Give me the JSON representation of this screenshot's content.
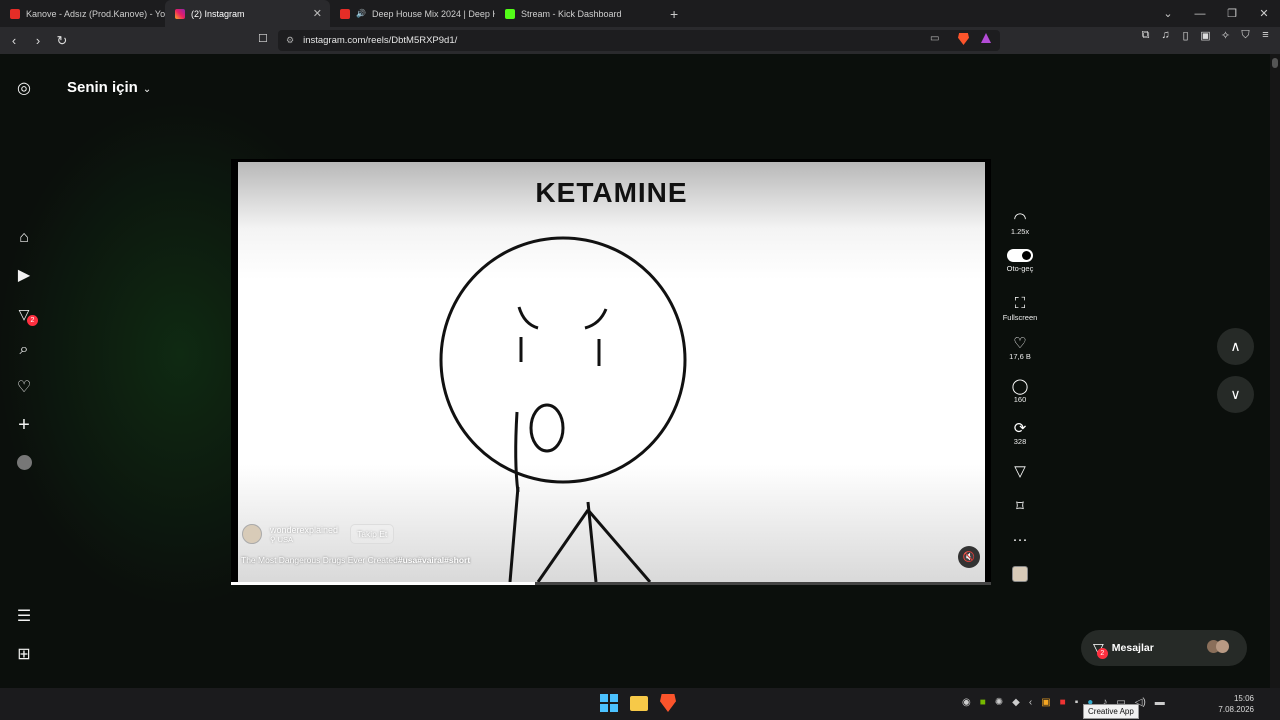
{
  "browser": {
    "tabs": [
      {
        "title": "Kanove - Adsız (Prod.Kanove) - YouTu",
        "favicon": "youtube-icon",
        "active": false
      },
      {
        "title": "(2) Instagram",
        "favicon": "instagram-icon",
        "active": true
      },
      {
        "title": "Deep House Mix 2024 | Deep Ho",
        "favicon": "youtube-icon",
        "active": false
      },
      {
        "title": "Stream - Kick Dashboard",
        "favicon": "kick-icon",
        "active": false
      }
    ],
    "url": "instagram.com/reels/DbtM5RXP9d1/"
  },
  "instagram": {
    "feed_title": "Senin için",
    "nav_badge": "2",
    "video": {
      "title_text": "KETAMINE",
      "owner": "wonderexplained",
      "location": "USA",
      "follow_label": "Takip Et",
      "caption_text": "The Most Dangerous Drugs Ever Created",
      "caption_tags": "#usa#vairal#short",
      "progress": 0.4
    },
    "actions": {
      "speed": "1.25x",
      "autoplay_label": "Oto-geç",
      "fullscreen_label": "Fullscreen",
      "likes": "17,6 B",
      "comments": "160",
      "reposts": "328"
    },
    "messages": {
      "label": "Mesajlar",
      "badge": "2"
    }
  },
  "taskbar": {
    "time": "15:06",
    "date": "7.08.2026",
    "tooltip": "Creative App"
  }
}
